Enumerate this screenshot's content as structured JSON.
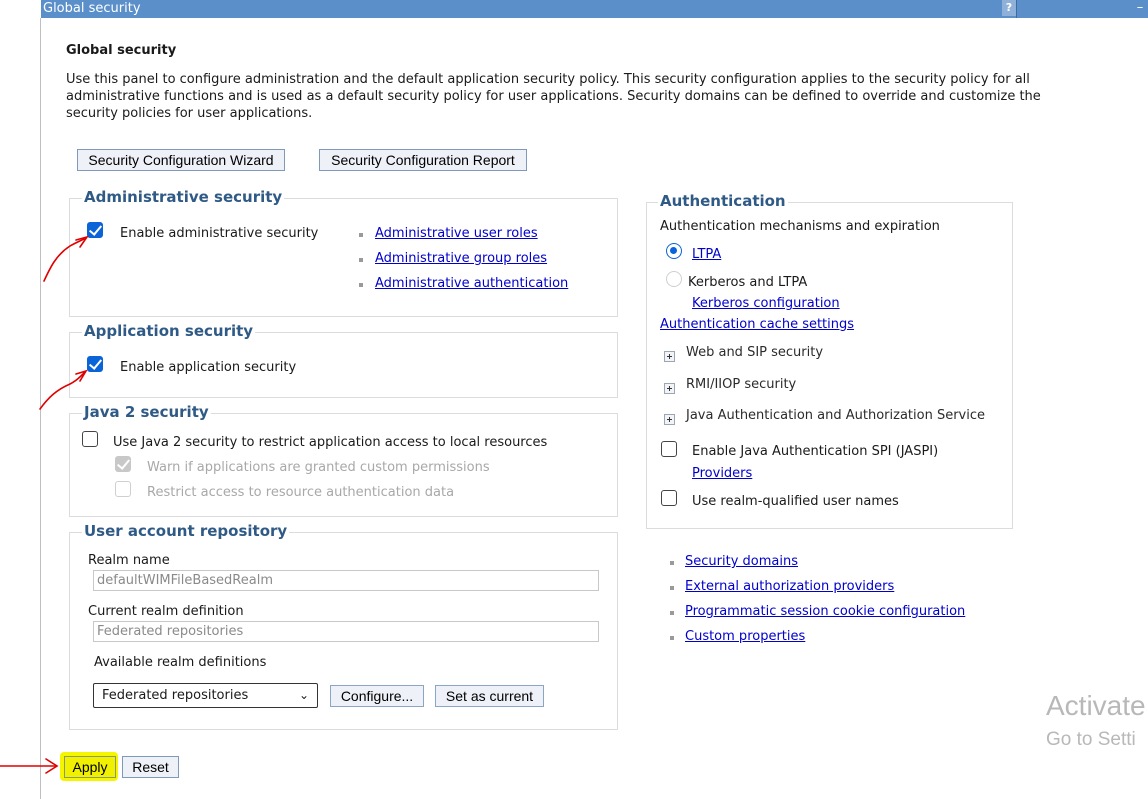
{
  "window": {
    "title": "Global security",
    "help_icon": "?",
    "minimize_icon": "–"
  },
  "page": {
    "heading": "Global security",
    "description": "Use this panel to configure administration and the default application security policy. This security configuration applies to the security policy for all administrative functions and is used as a default security policy for user applications. Security domains can be defined to override and customize the security policies for user applications."
  },
  "top_buttons": {
    "wizard": "Security Configuration Wizard",
    "report": "Security Configuration Report"
  },
  "admin_security": {
    "legend": "Administrative security",
    "enable_label": "Enable administrative security",
    "enable_checked": true,
    "links": [
      "Administrative user roles",
      "Administrative group roles",
      "Administrative authentication"
    ]
  },
  "app_security": {
    "legend": "Application security",
    "enable_label": "Enable application security",
    "enable_checked": true
  },
  "java2_security": {
    "legend": "Java 2 security",
    "use_label": "Use Java 2 security to restrict application access to local resources",
    "use_checked": false,
    "warn_label": "Warn if applications are granted custom permissions",
    "warn_checked": true,
    "restrict_label": "Restrict access to resource authentication data",
    "restrict_checked": false
  },
  "user_repo": {
    "legend": "User account repository",
    "realm_name_label": "Realm name",
    "realm_name_value": "defaultWIMFileBasedRealm",
    "current_def_label": "Current realm definition",
    "current_def_value": "Federated repositories",
    "available_label": "Available realm definitions",
    "available_selected": "Federated repositories",
    "configure_btn": "Configure...",
    "set_current_btn": "Set as current"
  },
  "authentication": {
    "legend": "Authentication",
    "mechanisms_label": "Authentication mechanisms and expiration",
    "ltpa_label": "LTPA",
    "kerberos_label": "Kerberos and LTPA",
    "kerberos_config_link": "Kerberos configuration",
    "cache_link": "Authentication cache settings",
    "web_sip": "Web and SIP security",
    "rmi_iiop": "RMI/IIOP security",
    "jaas": "Java Authentication and Authorization Service",
    "jaspi_label": "Enable Java Authentication SPI (JASPI)",
    "providers_link": "Providers",
    "realm_qualified_label": "Use realm-qualified user names"
  },
  "related_links": [
    "Security domains",
    "External authorization providers",
    "Programmatic session cookie configuration",
    "Custom properties"
  ],
  "bottom_buttons": {
    "apply": "Apply",
    "reset": "Reset"
  },
  "watermark": {
    "line1": "Activate",
    "line2": "Go to Setti"
  },
  "colors": {
    "titlebar": "#5b8fc9",
    "legend": "#2f5a86",
    "link": "#0000cc",
    "highlight": "#f5f500",
    "annotation": "#e00000"
  }
}
